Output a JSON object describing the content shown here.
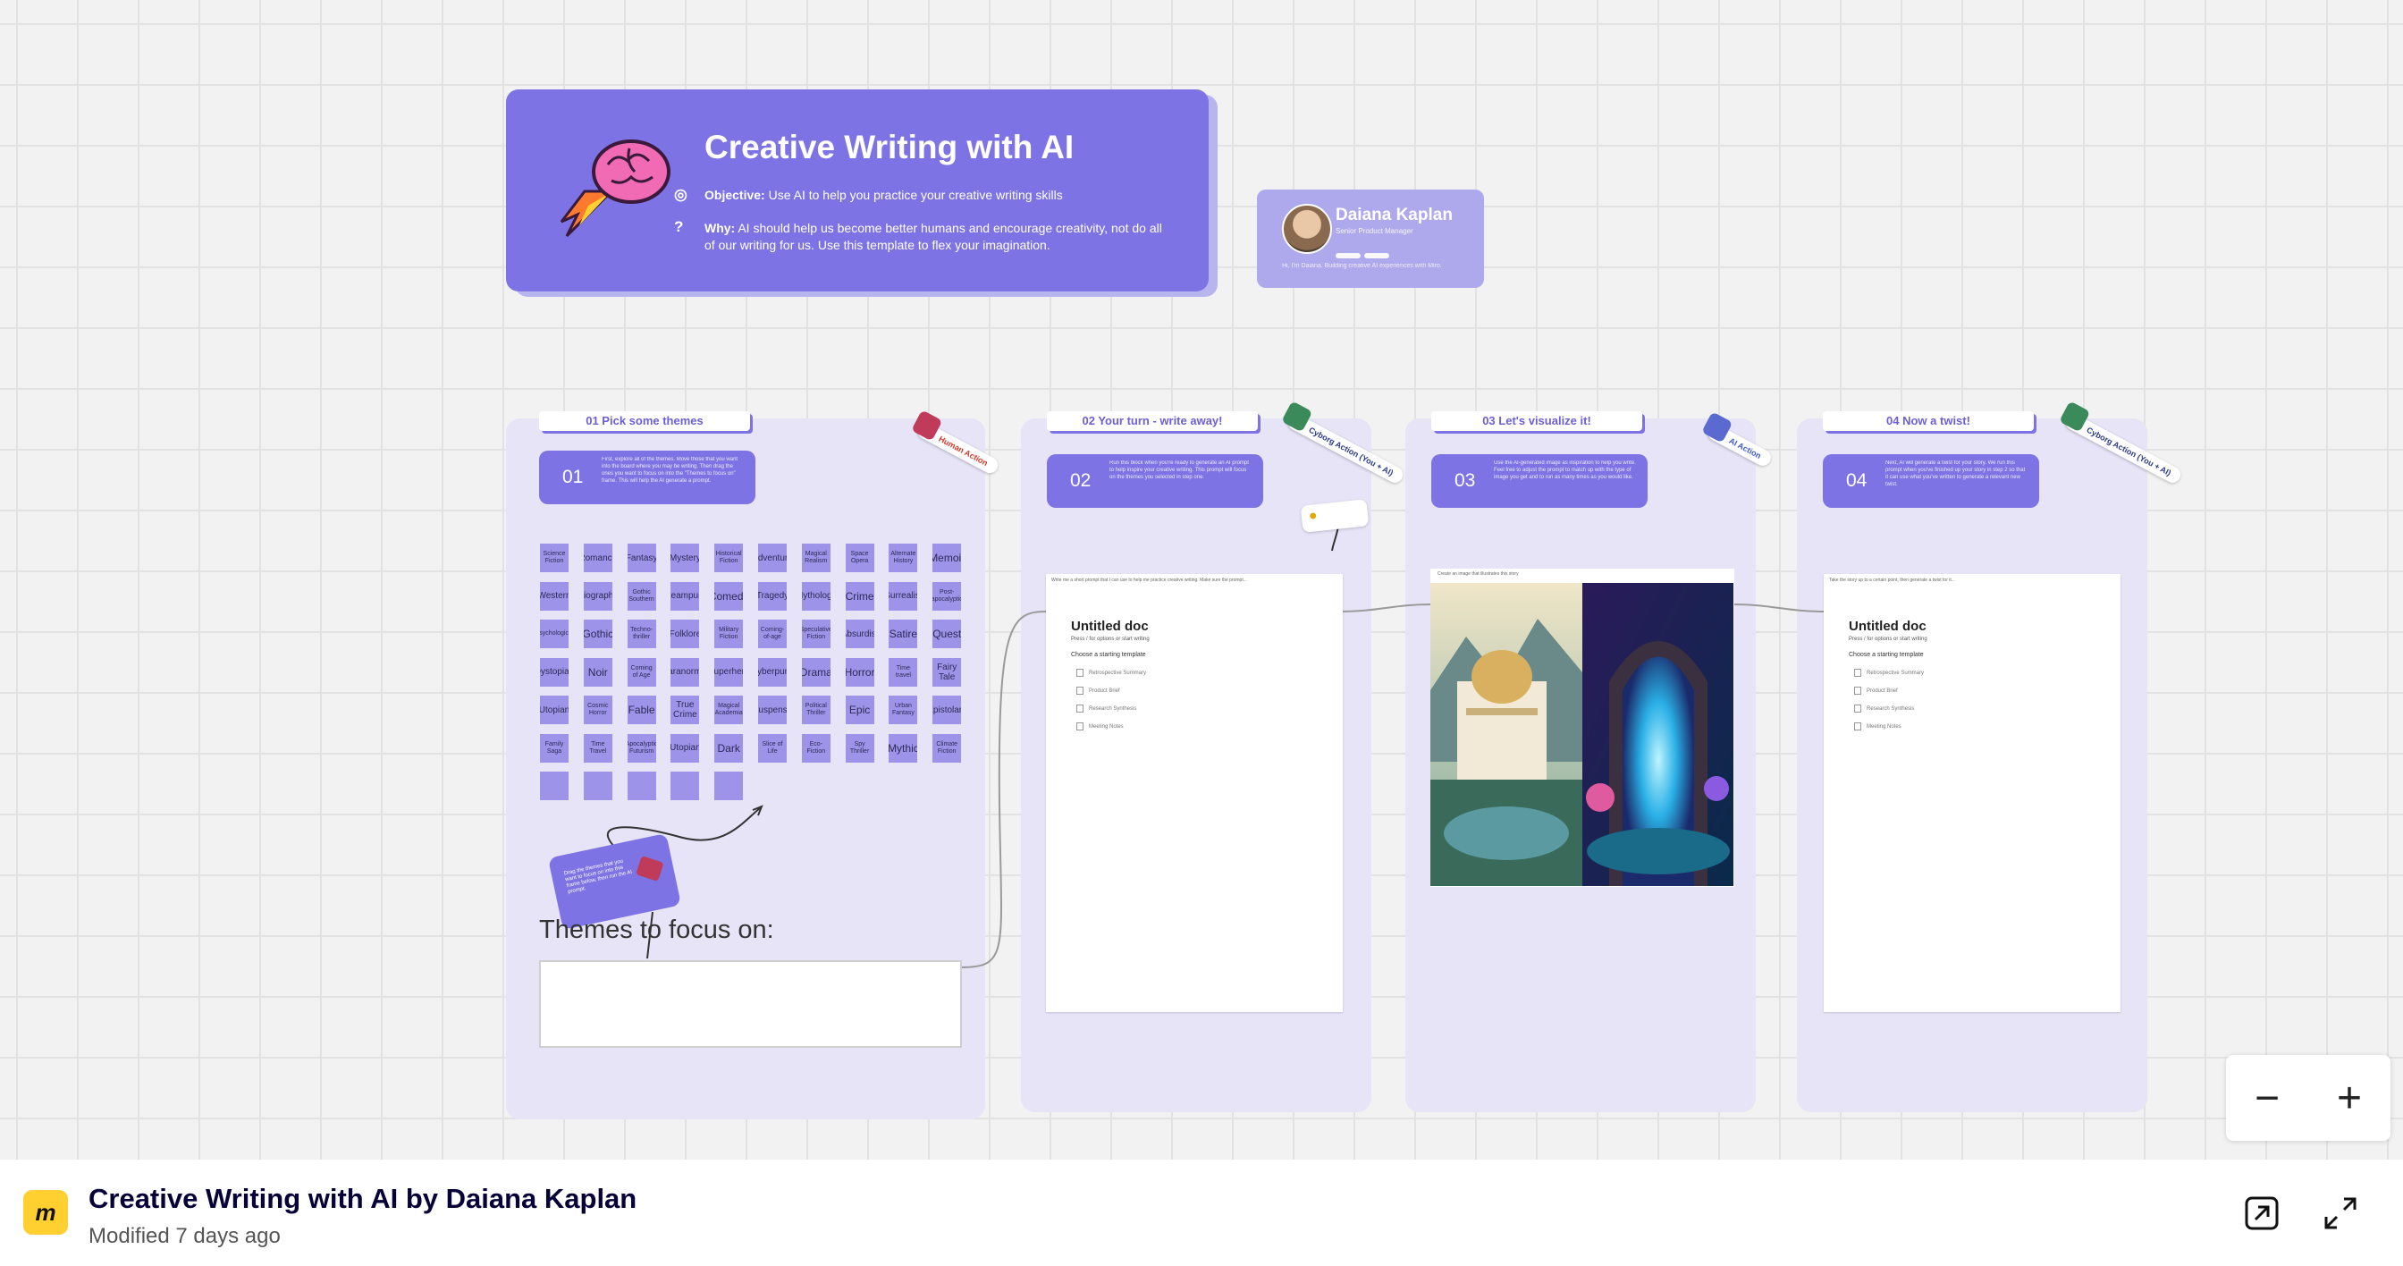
{
  "header": {
    "title": "Creative Writing with AI",
    "objective_label": "Objective:",
    "objective_text": "Use AI to help you practice your creative writing skills",
    "why_label": "Why:",
    "why_text": "AI should help us become better humans and encourage creativity, not do all of our writing for us. Use this template to flex your imagination."
  },
  "author": {
    "name": "Daiana Kaplan",
    "role": "Senior Product Manager",
    "bio": "Hi, I'm Daiana. Building creative AI experiences with Miro."
  },
  "steps": [
    {
      "label": "01 Pick some themes",
      "num": "01",
      "text": "First, explore all of the themes. Move those that you want into the board where you may be writing. Then drag the ones you want to focus on into the \"Themes to focus on\" frame. This will help the AI generate a prompt."
    },
    {
      "label": "02 Your turn - write away!",
      "num": "02",
      "text": "Run this block when you're ready to generate an AI prompt to help inspire your creative writing. This prompt will focus on the themes you selected in step one."
    },
    {
      "label": "03 Let's visualize it!",
      "num": "03",
      "text": "Use the AI-generated image as inspiration to help you write. Feel free to adjust the prompt to match up with the type of image you get and to run as many times as you would like."
    },
    {
      "label": "04 Now a twist!",
      "num": "04",
      "text": "Next, AI will generate a twist for your story. We run this prompt when you've finished up your story in step 2 so that it can use what you've written to generate a relevant new twist."
    }
  ],
  "stickers": {
    "human": "Human Action",
    "cyborg": "Cyborg Action (You + AI)",
    "ai": "AI Action"
  },
  "themes": [
    "Science Fiction",
    "Romance",
    "Fantasy",
    "Mystery",
    "Historical Fiction",
    "Adventure",
    "Magical Realism",
    "Space Opera",
    "Alternate History",
    "Memoir",
    "Western",
    "Biography",
    "Gothic Southern",
    "Steampunk",
    "Comedy",
    "Tragedy",
    "Mythology",
    "Crime",
    "Surrealist",
    "Post-apocalyptic",
    "Psychological",
    "Gothic",
    "Techno-thriller",
    "Folklore",
    "Military Fiction",
    "Coming-of-age",
    "Speculative Fiction",
    "Absurdist",
    "Satire",
    "Quest",
    "Dystopian",
    "Noir",
    "Coming of Age",
    "Paranormal",
    "Superhero",
    "Cyberpunk",
    "Drama",
    "Horror",
    "Time travel",
    "Fairy Tale",
    "Utopian",
    "Cosmic Horror",
    "Fable",
    "True Crime",
    "Magical Academia",
    "Suspense",
    "Political Thriller",
    "Epic",
    "Urban Fantasy",
    "Epistolary",
    "Family Saga",
    "Time Travel",
    "Apocalyptic Futurism",
    "Utopian",
    "Dark",
    "Slice of Life",
    "Eco-Fiction",
    "Spy Thriller",
    "Mythic",
    "Climate Fiction",
    "",
    "",
    "",
    "",
    ""
  ],
  "note": "Drag the themes that you want to focus on into this frame below, then run the AI prompt.",
  "focus_label": "Themes to focus on:",
  "doc_prompt_2": "Write me a short prompt that I can use to help me practice creative writing. Make sure the prompt...",
  "doc_prompt_4": "Take the story up to a certain point, then generate a twist for it...",
  "image_prompt": "Create an image that illustrates this story",
  "doc": {
    "title": "Untitled doc",
    "subtitle": "Press / for options or start writing",
    "template_heading": "Choose a starting template",
    "items": [
      "Retrospective Summary",
      "Product Brief",
      "Research Synthesis",
      "Meeting Notes"
    ]
  },
  "zoom": {
    "out": "−",
    "in": "+"
  },
  "footer": {
    "title": "Creative Writing with AI by Daiana Kaplan",
    "modified": "Modified 7 days ago"
  },
  "colors": {
    "accent": "#7e73e4",
    "column": "#e6e4f6",
    "miro_yellow": "#ffd02f"
  }
}
